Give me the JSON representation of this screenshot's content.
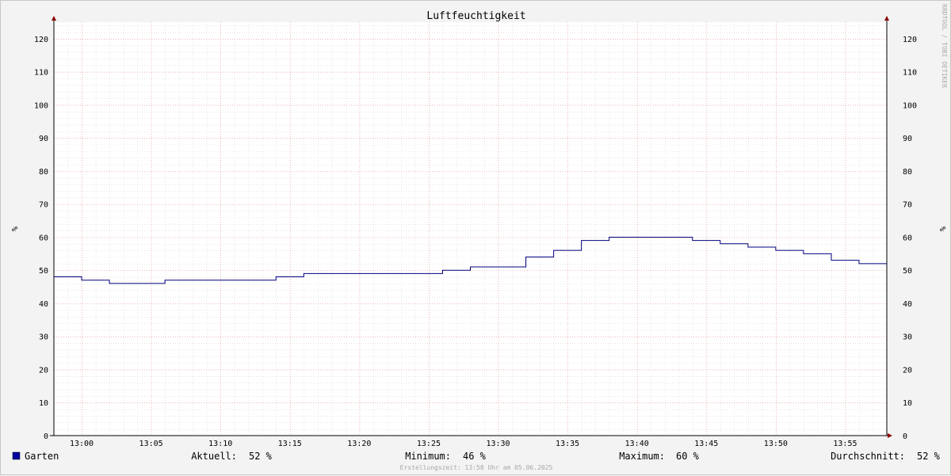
{
  "chart_data": {
    "type": "line",
    "title": "Luftfeuchtigkeit",
    "ylabel": "%",
    "ylabel_right": "%",
    "ylim": [
      0,
      125
    ],
    "yticks": [
      0,
      10,
      20,
      30,
      40,
      50,
      60,
      70,
      80,
      90,
      100,
      110,
      120
    ],
    "xlim": [
      "12:58",
      "13:58"
    ],
    "xticks": [
      "13:00",
      "13:05",
      "13:10",
      "13:15",
      "13:20",
      "13:25",
      "13:30",
      "13:35",
      "13:40",
      "13:45",
      "13:50",
      "13:55"
    ],
    "grid": true,
    "step": true,
    "watermark": "RRDTOOL / TOBI OETIKER",
    "series": [
      {
        "name": "Garten",
        "color": "#00007f",
        "x": [
          "12:58",
          "13:00",
          "13:02",
          "13:06",
          "13:14",
          "13:16",
          "13:26",
          "13:28",
          "13:32",
          "13:34",
          "13:36",
          "13:38",
          "13:44",
          "13:46",
          "13:48",
          "13:50",
          "13:52",
          "13:54",
          "13:56",
          "13:58"
        ],
        "y": [
          48,
          47,
          46,
          47,
          48,
          49,
          50,
          51,
          54,
          56,
          59,
          60,
          59,
          58,
          57,
          56,
          55,
          53,
          52,
          52
        ]
      }
    ],
    "legend": {
      "series_label": "Garten",
      "swatch_color": "#00009f",
      "stats": [
        {
          "label": "Aktuell:",
          "value": "52 %"
        },
        {
          "label": "Minimum:",
          "value": "46 %"
        },
        {
          "label": "Maximum:",
          "value": "60 %"
        },
        {
          "label": "Durchschnitt:",
          "value": "52 %"
        }
      ]
    },
    "footer": "Erstellungszeit: 13:58 Uhr am 05.06.2025"
  }
}
